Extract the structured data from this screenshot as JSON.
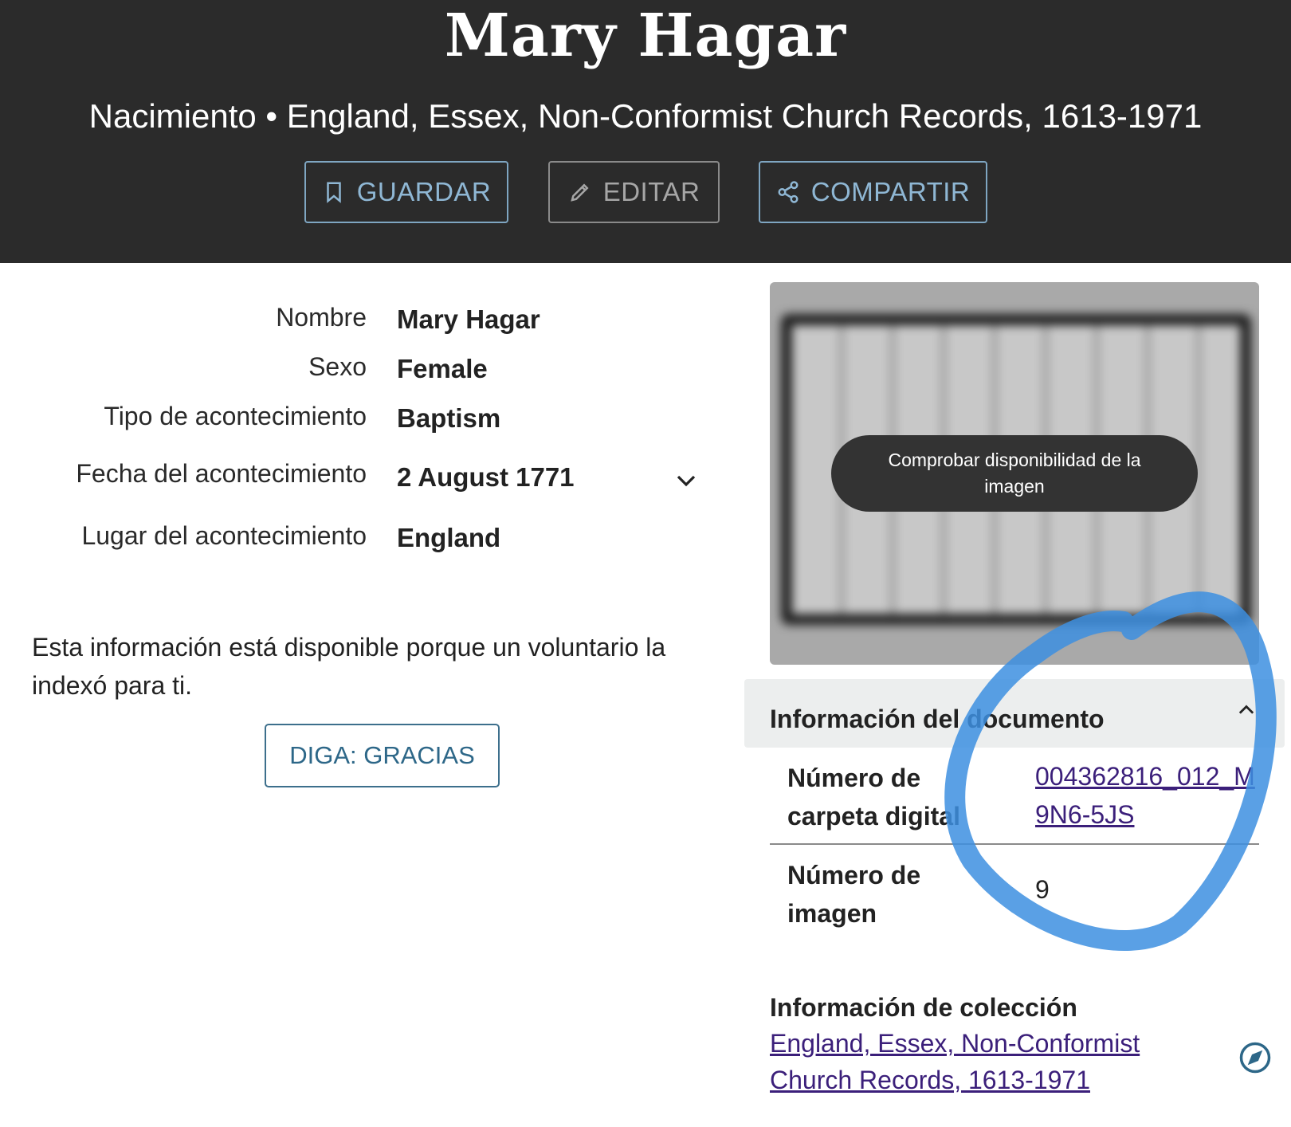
{
  "header": {
    "title": "Mary Hagar",
    "subtitle": "Nacimiento • England, Essex, Non-Conformist Church Records, 1613-1971",
    "buttons": {
      "save": "GUARDAR",
      "edit": "EDITAR",
      "share": "COMPARTIR"
    }
  },
  "details": {
    "name_label": "Nombre",
    "name_value": "Mary Hagar",
    "sex_label": "Sexo",
    "sex_value": "Female",
    "event_type_label": "Tipo de acontecimiento",
    "event_type_value": "Baptism",
    "event_date_label": "Fecha del acontecimiento",
    "event_date_value": "2 August 1771",
    "event_place_label": "Lugar del acontecimiento",
    "event_place_value": "England"
  },
  "volunteer_note": "Esta información está disponible porque un voluntario la indexó para ti.",
  "thanks_button": "DIGA: GRACIAS",
  "image_card": {
    "availability_button": "Comprobar disponibilidad de la imagen"
  },
  "document_info": {
    "title": "Información del documento",
    "digital_folder_label_1": "Número de",
    "digital_folder_label_2": "carpeta digital",
    "digital_folder_value": "004362816_012_M9N6-5JS",
    "image_number_label_1": "Número de",
    "image_number_label_2": "imagen",
    "image_number_value": "9"
  },
  "collection_info": {
    "title": "Información de colección",
    "link": "England, Essex, Non-Conformist Church Records, 1613-1971"
  },
  "colors": {
    "header_bg": "#2b2b2b",
    "button_accent": "#8fb7d4",
    "link": "#3b1f7a",
    "annotation": "#3d8fe0"
  },
  "icons": [
    "bookmark-icon",
    "pencil-icon",
    "share-icon",
    "chevron-down-icon",
    "chevron-up-icon",
    "compass-icon"
  ]
}
